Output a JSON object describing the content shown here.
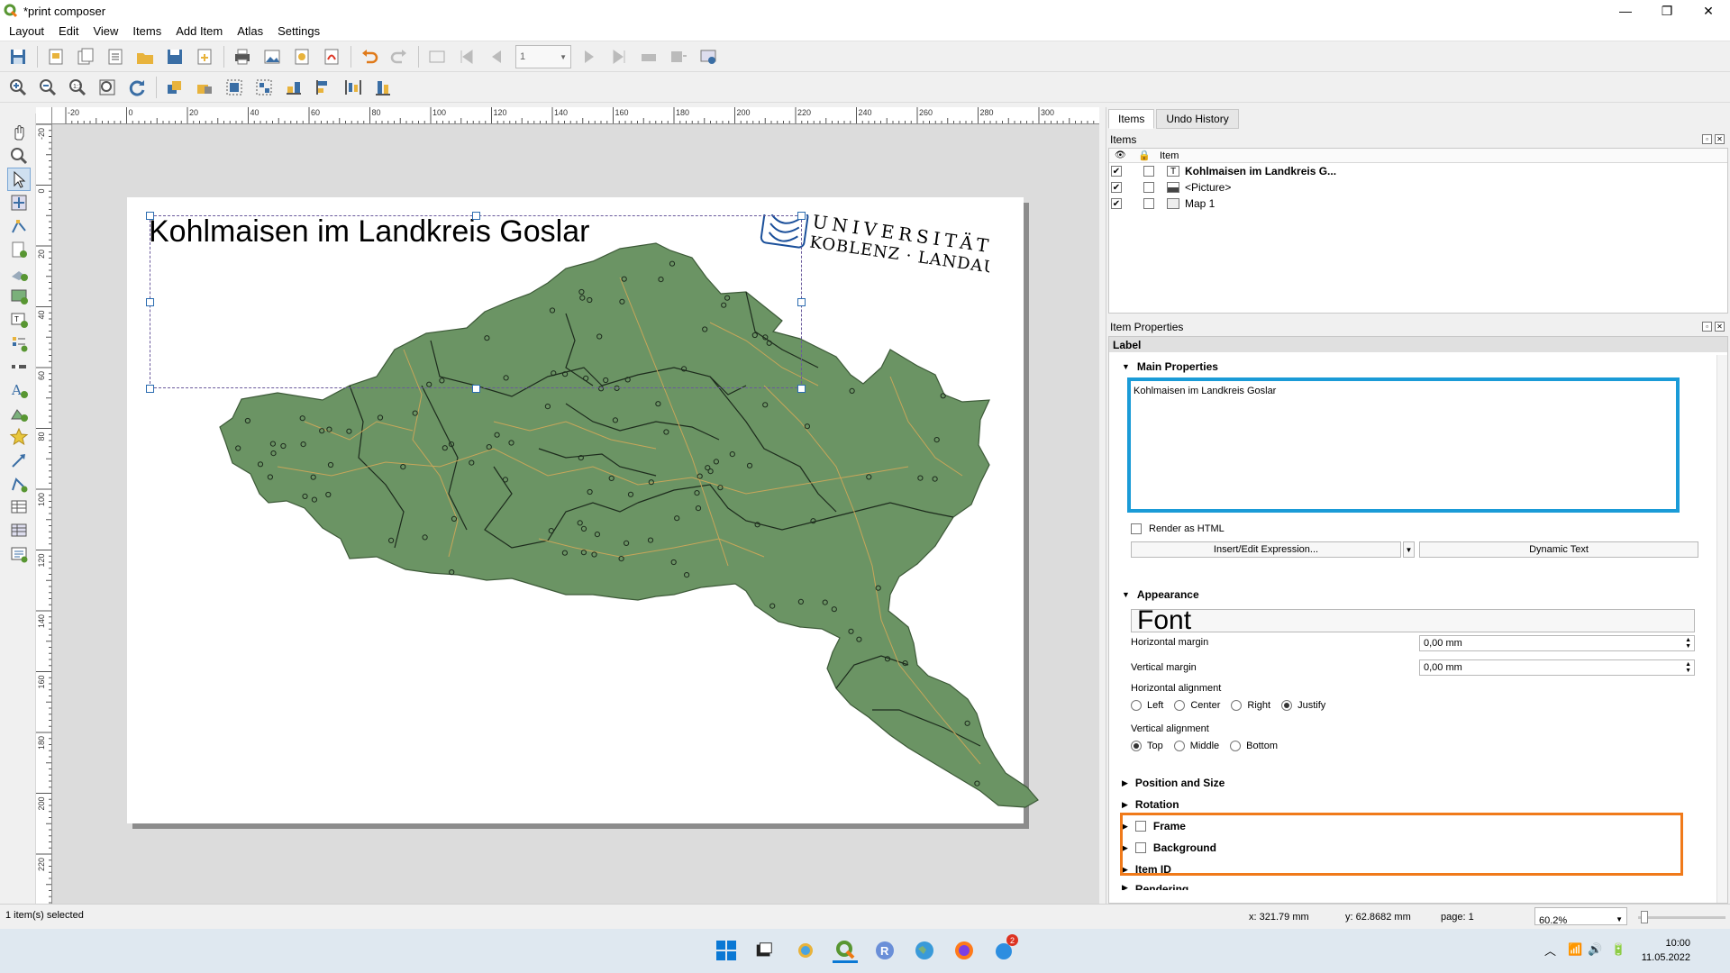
{
  "window": {
    "title": "*print composer",
    "minimize": "—",
    "maximize": "❐",
    "close": "✕"
  },
  "menu": [
    "Layout",
    "Edit",
    "View",
    "Items",
    "Add Item",
    "Atlas",
    "Settings"
  ],
  "atlas": {
    "page_field": "1"
  },
  "ruler": {
    "top_labels": [
      "-20",
      "0",
      "20",
      "40",
      "60",
      "80",
      "100",
      "120",
      "140",
      "160",
      "180",
      "200",
      "220",
      "240",
      "260",
      "280",
      "300",
      "3"
    ],
    "left_labels": [
      "-20",
      "0",
      "20",
      "40",
      "60",
      "80",
      "100",
      "120",
      "140",
      "160",
      "180",
      "200",
      "220"
    ]
  },
  "canvas": {
    "map_title": "Kohlmaisen im Landkreis Goslar",
    "logo_line1": "UNIVERSITÄT",
    "logo_line2": "KOBLENZ · LANDAU",
    "map_fill": "#6b9464",
    "map_lines": "#c8a65a"
  },
  "panel": {
    "tabs": [
      "Items",
      "Undo History"
    ],
    "items_label": "Items",
    "item_col": "Item",
    "items": [
      {
        "name": "Kohlmaisen im Landkreis G...",
        "bold": true
      },
      {
        "name": "<Picture>",
        "bold": false
      },
      {
        "name": "Map 1",
        "bold": false
      }
    ],
    "props_label": "Item Properties",
    "props_type": "Label",
    "main_props": "Main Properties",
    "label_text": "Kohlmaisen im Landkreis Goslar",
    "render_html": "Render as HTML",
    "insert_expr": "Insert/Edit Expression...",
    "dynamic_text": "Dynamic Text",
    "appearance": "Appearance",
    "font_btn": "Font",
    "hmargin_label": "Horizontal margin",
    "hmargin_val": "0,00 mm",
    "vmargin_label": "Vertical margin",
    "vmargin_val": "0,00 mm",
    "halign_label": "Horizontal alignment",
    "halign": [
      "Left",
      "Center",
      "Right",
      "Justify"
    ],
    "valign_label": "Vertical alignment",
    "valign": [
      "Top",
      "Middle",
      "Bottom"
    ],
    "groups": [
      "Position and Size",
      "Rotation",
      "Frame",
      "Background",
      "Item ID",
      "Rendering"
    ],
    "highlight_blue": "#1a9bd7",
    "highlight_orange": "#f07a1a"
  },
  "status": {
    "selected": "1 item(s) selected",
    "x": "x: 321.79 mm",
    "y": "y: 62.8682 mm",
    "page": "page: 1",
    "zoom": "60.2%"
  },
  "taskbar": {
    "time": "10:00",
    "date": "11.05.2022",
    "badge": "2"
  }
}
